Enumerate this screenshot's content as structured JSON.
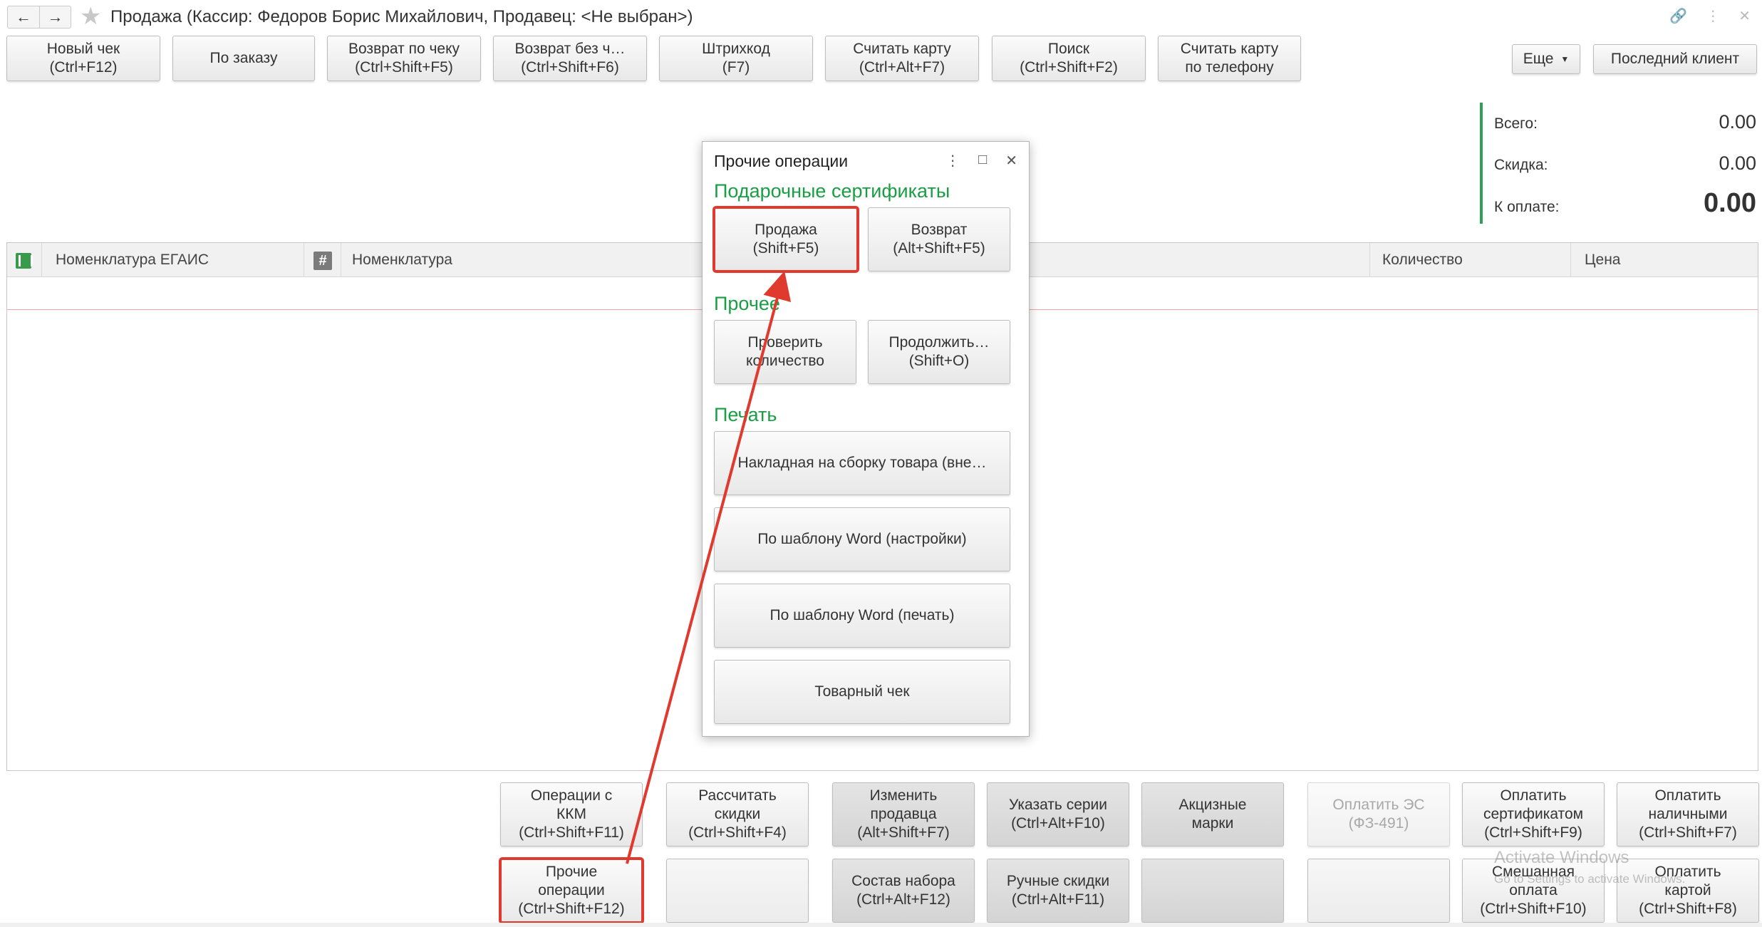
{
  "window": {
    "title": "Продажа (Кассир: Федоров Борис Михайлович, Продавец: <Не выбран>)",
    "back_icon": "←",
    "forward_icon": "→"
  },
  "toolbar": {
    "new_check": "Новый чек",
    "new_check_key": "(Ctrl+F12)",
    "by_order": "По заказу",
    "return_by_check": "Возврат по чеку",
    "return_by_check_key": "(Ctrl+Shift+F5)",
    "return_no_check": "Возврат без ч…",
    "return_no_check_key": "(Ctrl+Shift+F6)",
    "barcode": "Штрихкод",
    "barcode_key": "(F7)",
    "read_card": "Считать карту",
    "read_card_key": "(Ctrl+Alt+F7)",
    "search": "Поиск",
    "search_key": "(Ctrl+Shift+F2)",
    "card_by_phone_1": "Считать карту",
    "card_by_phone_2": "по телефону",
    "more": "Еще",
    "last_client": "Последний клиент"
  },
  "totals": {
    "total_label": "Всего:",
    "total_value": "0.00",
    "discount_label": "Скидка:",
    "discount_value": "0.00",
    "to_pay_label": "К оплате:",
    "to_pay_value": "0.00"
  },
  "table": {
    "columns": {
      "egais": "Номенклатура ЕГАИС",
      "hash": "#",
      "nomenclature": "Номенклатура",
      "quantity": "Количество",
      "price": "Цена"
    }
  },
  "popup": {
    "title": "Прочие операции",
    "groups": {
      "gift": "Подарочные сертификаты",
      "other": "Прочее",
      "print": "Печать"
    },
    "sale": "Продажа",
    "sale_key": "(Shift+F5)",
    "return": "Возврат",
    "return_key": "(Alt+Shift+F5)",
    "check_qty_1": "Проверить",
    "check_qty_2": "количество",
    "continue": "Продолжить…",
    "continue_key": "(Shift+O)",
    "invoice": "Накладная на сборку товара (вне…",
    "word_settings": "По шаблону Word (настройки)",
    "word_print": "По шаблону Word (печать)",
    "sales_receipt": "Товарный чек"
  },
  "bottom": {
    "kkm_1": "Операции с",
    "kkm_2": "ККМ",
    "kkm_key": "(Ctrl+Shift+F11)",
    "calc_1": "Рассчитать",
    "calc_2": "скидки",
    "calc_key": "(Ctrl+Shift+F4)",
    "seller_1": "Изменить",
    "seller_2": "продавца",
    "seller_key": "(Alt+Shift+F7)",
    "series_1": "Указать серии",
    "series_key": "(Ctrl+Alt+F10)",
    "excise_1": "Акцизные",
    "excise_2": "марки",
    "es_1": "Оплатить ЭС",
    "es_2": "(ФЗ-491)",
    "cert_1": "Оплатить",
    "cert_2": "сертификатом",
    "cert_key": "(Ctrl+Shift+F9)",
    "cash_1": "Оплатить",
    "cash_2": "наличными",
    "cash_key": "(Ctrl+Shift+F7)",
    "other_1": "Прочие",
    "other_2": "операции",
    "other_key": "(Ctrl+Shift+F12)",
    "kit_1": "Состав набора",
    "kit_key": "(Ctrl+Alt+F12)",
    "manual_1": "Ручные скидки",
    "manual_key": "(Ctrl+Alt+F11)",
    "mixed_1": "Смешанная",
    "mixed_2": "оплата",
    "mixed_key": "(Ctrl+Shift+F10)",
    "card_1": "Оплатить",
    "card_2": "картой",
    "card_key": "(Ctrl+Shift+F8)"
  },
  "watermark": {
    "line1": "Activate Windows",
    "line2": "Go to Settings to activate Windows."
  },
  "colors": {
    "accent_green": "#1a9e43",
    "highlight_red": "#e03a2f"
  }
}
